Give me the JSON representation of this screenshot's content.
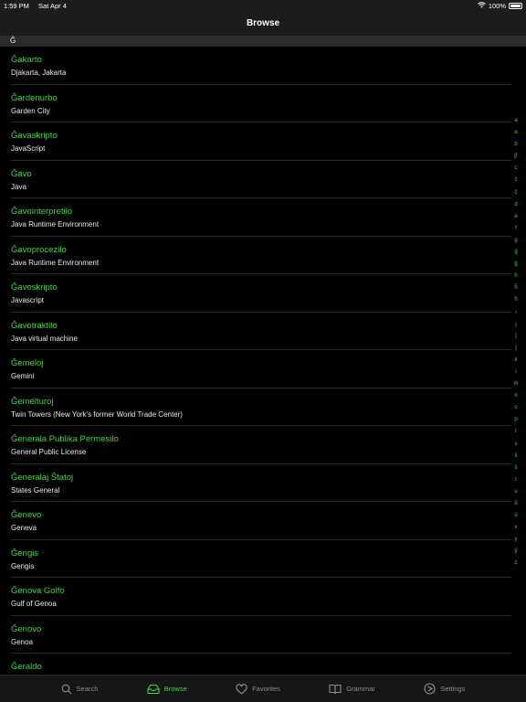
{
  "status": {
    "time": "1:59 PM",
    "date": "Sat Apr 4",
    "battery": "100%",
    "battery_level": 1.0
  },
  "nav": {
    "title": "Browse"
  },
  "section": {
    "header": "Ĝ"
  },
  "entries": [
    {
      "term": "Ĝakarto",
      "translation": "Djakarta, Jakarta"
    },
    {
      "term": "Ĝardenurbo",
      "translation": "Garden City"
    },
    {
      "term": "Ĝavaskripto",
      "translation": "JavaScript"
    },
    {
      "term": "Ĝavo",
      "translation": "Java"
    },
    {
      "term": "Ĝavointerpretilo",
      "translation": "Java Runtime Environment"
    },
    {
      "term": "Ĝavoprocezilo",
      "translation": "Java Runtime Environment"
    },
    {
      "term": "Ĝavoskripto",
      "translation": "Javascript"
    },
    {
      "term": "Ĝavotraktilo",
      "translation": "Java virtual machine"
    },
    {
      "term": "Ĝemeloj",
      "translation": "Gemini"
    },
    {
      "term": "Ĝemelturoj",
      "translation": "Twin Towers (New York's former World Trade Center)"
    },
    {
      "term": "Ĝenerala Publika Permesilo",
      "translation": "General Public License"
    },
    {
      "term": "Ĝeneralaj Ŝtatoj",
      "translation": "States General"
    },
    {
      "term": "Ĝenevo",
      "translation": "Geneva"
    },
    {
      "term": "Ĝengis",
      "translation": "Gengis"
    },
    {
      "term": "Ĝenova Golfo",
      "translation": "Gulf of Genoa"
    },
    {
      "term": "Ĝenovo",
      "translation": "Genoa"
    },
    {
      "term": "Ĝeraldo",
      "translation": ""
    }
  ],
  "index": [
    "a",
    "α",
    "b",
    "β",
    "c",
    "ĉ",
    "č",
    "d",
    "e",
    "f",
    "g",
    "ĝ",
    "ğ",
    "h",
    "ĥ",
    "ħ",
    "i",
    "j",
    "ĵ",
    "ǰ",
    "k",
    "l",
    "m",
    "n",
    "o",
    "p",
    "r",
    "s",
    "ŝ",
    "š",
    "t",
    "u",
    "ŭ",
    "ü",
    "v",
    "y",
    "ÿ",
    "z"
  ],
  "tabs": [
    {
      "label": "Search",
      "icon": "search-icon",
      "active": false
    },
    {
      "label": "Browse",
      "icon": "browse-icon",
      "active": true
    },
    {
      "label": "Favorites",
      "icon": "heart-icon",
      "active": false
    },
    {
      "label": "Grammar",
      "icon": "book-icon",
      "active": false
    },
    {
      "label": "Settings",
      "icon": "settings-icon",
      "active": false
    }
  ],
  "colors": {
    "accent": "#3ed63e",
    "background": "#000000",
    "bar": "#1c1c1e",
    "inactive": "#8e8e93"
  }
}
